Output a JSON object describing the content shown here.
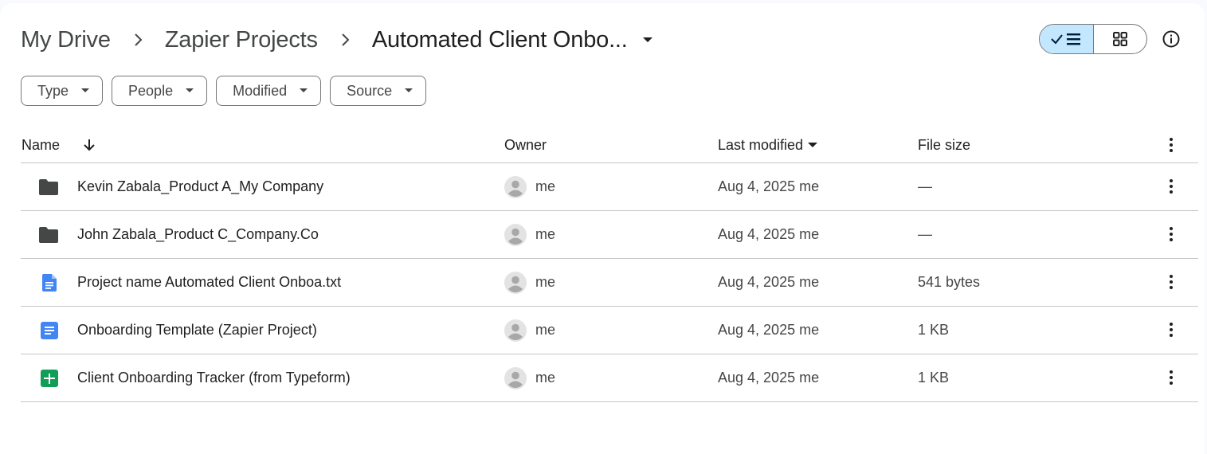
{
  "breadcrumb": {
    "items": [
      "My Drive",
      "Zapier Projects"
    ],
    "current": "Automated Client Onbo..."
  },
  "filters": [
    "Type",
    "People",
    "Modified",
    "Source"
  ],
  "table": {
    "headers": {
      "name": "Name",
      "owner": "Owner",
      "modified": "Last modified",
      "size": "File size"
    },
    "rows": [
      {
        "icon": "folder-icon",
        "name": "Kevin Zabala_Product A_My Company",
        "owner": "me",
        "modified": "Aug 4, 2025",
        "modified_by": "me",
        "size": "—"
      },
      {
        "icon": "folder-icon",
        "name": "John Zabala_Product C_Company.Co",
        "owner": "me",
        "modified": "Aug 4, 2025",
        "modified_by": "me",
        "size": "—"
      },
      {
        "icon": "text-file-icon",
        "name": "Project name Automated Client Onboa.txt",
        "owner": "me",
        "modified": "Aug 4, 2025",
        "modified_by": "me",
        "size": "541 bytes"
      },
      {
        "icon": "google-docs-icon",
        "name": "Onboarding Template (Zapier Project)",
        "owner": "me",
        "modified": "Aug 4, 2025",
        "modified_by": "me",
        "size": "1 KB"
      },
      {
        "icon": "google-sheets-icon",
        "name": "Client Onboarding Tracker (from Typeform)",
        "owner": "me",
        "modified": "Aug 4, 2025",
        "modified_by": "me",
        "size": "1 KB"
      }
    ]
  },
  "colors": {
    "toggle_active": "#c2e7ff",
    "folder": "#444746",
    "docs_blue": "#4285f4",
    "sheets_green": "#0f9d58",
    "divider": "#c4c7c5"
  }
}
